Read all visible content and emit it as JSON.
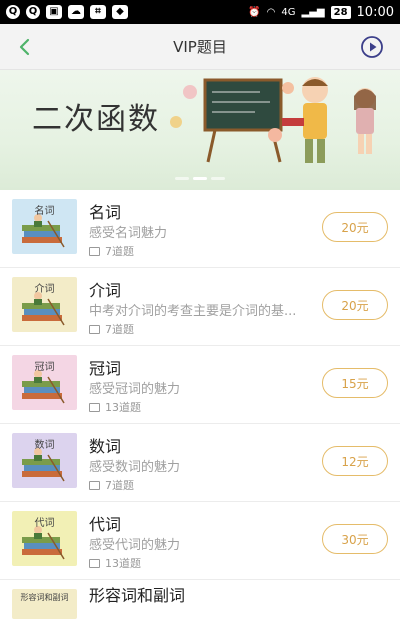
{
  "statusbar": {
    "network": "4G",
    "battery": "28",
    "time": "10:00"
  },
  "navbar": {
    "title": "VIP题目"
  },
  "banner": {
    "title": "二次函数"
  },
  "items": [
    {
      "thumb_label": "名词",
      "title": "名词",
      "desc": "感受名词魅力",
      "meta": "7道题",
      "price": "20元",
      "thumb_color": "#cfe6f3"
    },
    {
      "thumb_label": "介词",
      "title": "介词",
      "desc": "中考对介词的考查主要是介词的基...",
      "meta": "7道题",
      "price": "20元",
      "thumb_color": "#f3ecc8"
    },
    {
      "thumb_label": "冠词",
      "title": "冠词",
      "desc": "感受冠词的魅力",
      "meta": "13道题",
      "price": "15元",
      "thumb_color": "#f4d6e4"
    },
    {
      "thumb_label": "数词",
      "title": "数词",
      "desc": "感受数词的魅力",
      "meta": "7道题",
      "price": "12元",
      "thumb_color": "#dcd3ee"
    },
    {
      "thumb_label": "代词",
      "title": "代词",
      "desc": "感受代词的魅力",
      "meta": "13道题",
      "price": "30元",
      "thumb_color": "#f2f0b5"
    },
    {
      "thumb_label": "形容词和副词",
      "title": "形容词和副词",
      "thumb_color": "#f3ecc8"
    }
  ]
}
